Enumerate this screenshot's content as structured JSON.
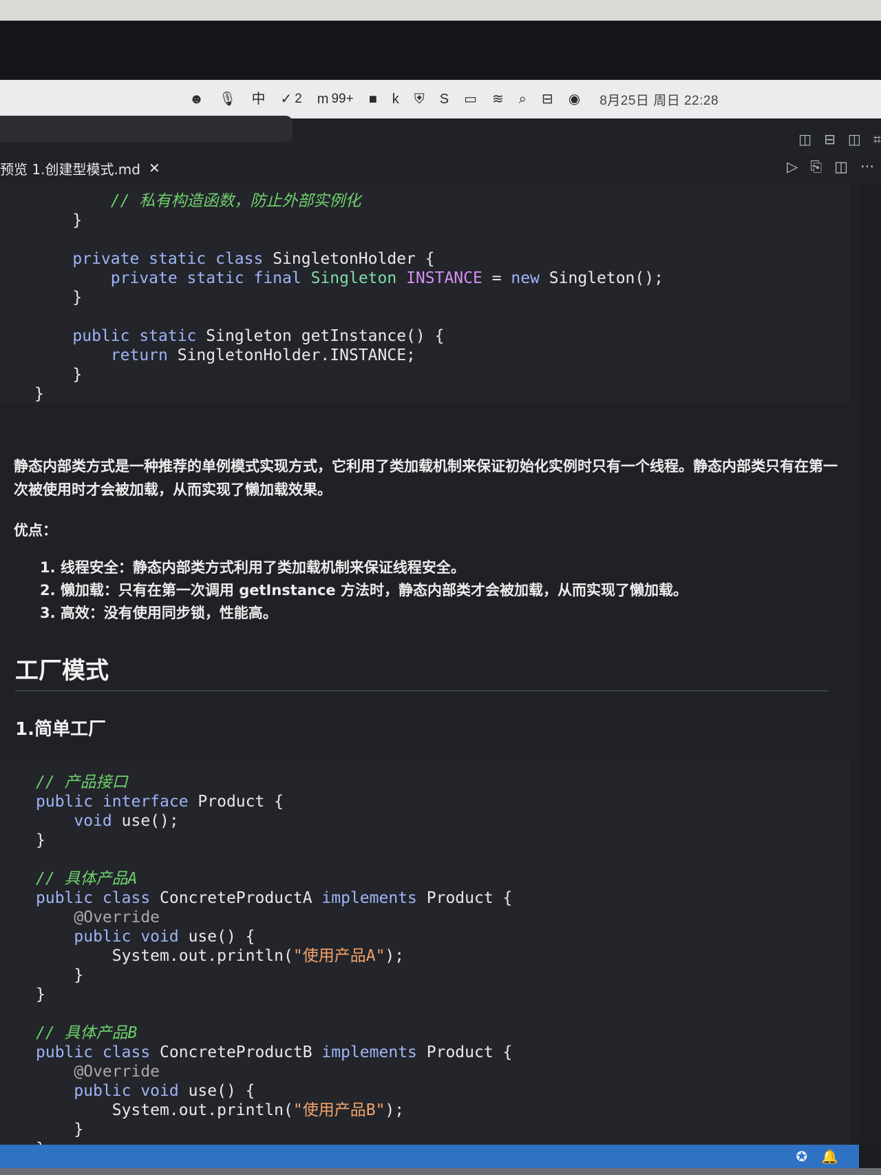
{
  "menubar": {
    "items": [
      {
        "icon": "smiley-icon",
        "glyph": "☻",
        "text": ""
      },
      {
        "icon": "microphone-icon",
        "glyph": "🎙",
        "text": ""
      },
      {
        "icon": "input-method-icon",
        "glyph": "中",
        "text": ""
      },
      {
        "icon": "check-circle-icon",
        "glyph": "✓",
        "text": "2"
      },
      {
        "icon": "m-app-icon",
        "glyph": "m",
        "text": "99+"
      },
      {
        "icon": "red-app-icon",
        "glyph": "■",
        "text": ""
      },
      {
        "icon": "k-app-icon",
        "glyph": "k",
        "text": ""
      },
      {
        "icon": "shield-icon",
        "glyph": "⛨",
        "text": ""
      },
      {
        "icon": "s-app-icon",
        "glyph": "S",
        "text": ""
      },
      {
        "icon": "battery-icon",
        "glyph": "▭",
        "text": ""
      },
      {
        "icon": "wifi-icon",
        "glyph": "≋",
        "text": ""
      },
      {
        "icon": "search-icon",
        "glyph": "⌕",
        "text": ""
      },
      {
        "icon": "control-center-icon",
        "glyph": "⊟",
        "text": ""
      },
      {
        "icon": "siri-icon",
        "glyph": "◉",
        "text": ""
      }
    ],
    "clock": "8月25日 周日  22:28"
  },
  "titlebar": {
    "layout_icons": [
      "sidebar-left-icon",
      "panel-bottom-icon",
      "sidebar-right-icon"
    ],
    "layout_glyphs": [
      "◫",
      "⊟",
      "◫",
      "⌗"
    ]
  },
  "tab": {
    "label": "预览 1.创建型模式.md",
    "close": "✕",
    "actions": [
      "▷",
      "⎘",
      "◫",
      "···"
    ]
  },
  "article": {
    "paragraph": "静态内部类方式是一种推荐的单例模式实现方式，它利用了类加载机制来保证初始化实例时只有一个线程。静态内部类只有在第一次被使用时才会被加载，从而实现了懒加载效果。",
    "advantages_label": "优点：",
    "advantages": [
      "1. 线程安全：静态内部类方式利用了类加载机制来保证线程安全。",
      "2. 懒加载：只有在第一次调用 getInstance 方法时，静态内部类才会被加载，从而实现了懒加载。",
      "3. 高效：没有使用同步锁，性能高。"
    ],
    "heading": "工厂模式",
    "subheading": "1.简单工厂"
  },
  "code": {
    "block1": [
      [
        [
          "",
          "        "
        ],
        [
          "cm",
          "// 私有构造函数，防止外部实例化"
        ]
      ],
      [
        [
          "",
          "    }"
        ]
      ],
      [
        [
          "",
          ""
        ]
      ],
      [
        [
          "",
          "    "
        ],
        [
          "kw",
          "private static class "
        ],
        [
          "",
          "SingletonHolder {"
        ]
      ],
      [
        [
          "",
          "        "
        ],
        [
          "kw",
          "private static final "
        ],
        [
          "ty",
          "Singleton "
        ],
        [
          "cn",
          "INSTANCE"
        ],
        [
          "",
          " = "
        ],
        [
          "kw",
          "new "
        ],
        [
          "",
          "Singleton();"
        ]
      ],
      [
        [
          "",
          "    }"
        ]
      ],
      [
        [
          "",
          ""
        ]
      ],
      [
        [
          "",
          "    "
        ],
        [
          "kw",
          "public static "
        ],
        [
          "",
          "Singleton getInstance() {"
        ]
      ],
      [
        [
          "",
          "        "
        ],
        [
          "kw",
          "return "
        ],
        [
          "",
          "SingletonHolder.INSTANCE;"
        ]
      ],
      [
        [
          "",
          "    }"
        ]
      ],
      [
        [
          "",
          "}"
        ]
      ]
    ],
    "block2": [
      [
        [
          "cm",
          "// 产品接口"
        ]
      ],
      [
        [
          "kw",
          "public interface "
        ],
        [
          "",
          "Product {"
        ]
      ],
      [
        [
          "",
          "    "
        ],
        [
          "kw",
          "void "
        ],
        [
          "",
          "use();"
        ]
      ],
      [
        [
          "",
          "}"
        ]
      ],
      [
        [
          "",
          ""
        ]
      ],
      [
        [
          "cm",
          "// 具体产品A"
        ]
      ],
      [
        [
          "kw",
          "public class "
        ],
        [
          "",
          "ConcreteProductA "
        ],
        [
          "kw",
          "implements "
        ],
        [
          "",
          "Product {"
        ]
      ],
      [
        [
          "",
          "    "
        ],
        [
          "an",
          "@Override"
        ]
      ],
      [
        [
          "",
          "    "
        ],
        [
          "kw",
          "public void "
        ],
        [
          "",
          "use() {"
        ]
      ],
      [
        [
          "",
          "        System.out.println("
        ],
        [
          "st",
          "\"使用产品A\""
        ],
        [
          "",
          ");"
        ]
      ],
      [
        [
          "",
          "    }"
        ]
      ],
      [
        [
          "",
          "}"
        ]
      ],
      [
        [
          "",
          ""
        ]
      ],
      [
        [
          "cm",
          "// 具体产品B"
        ]
      ],
      [
        [
          "kw",
          "public class "
        ],
        [
          "",
          "ConcreteProductB "
        ],
        [
          "kw",
          "implements "
        ],
        [
          "",
          "Product {"
        ]
      ],
      [
        [
          "",
          "    "
        ],
        [
          "an",
          "@Override"
        ]
      ],
      [
        [
          "",
          "    "
        ],
        [
          "kw",
          "public void "
        ],
        [
          "",
          "use() {"
        ]
      ],
      [
        [
          "",
          "        System.out.println("
        ],
        [
          "st",
          "\"使用产品B\""
        ],
        [
          "",
          ");"
        ]
      ],
      [
        [
          "",
          "    }"
        ]
      ],
      [
        [
          "",
          "}"
        ]
      ]
    ]
  },
  "statusbar": {
    "icons": [
      "copilot-icon",
      "bell-icon"
    ],
    "glyphs": [
      "✪",
      "🔔"
    ]
  }
}
